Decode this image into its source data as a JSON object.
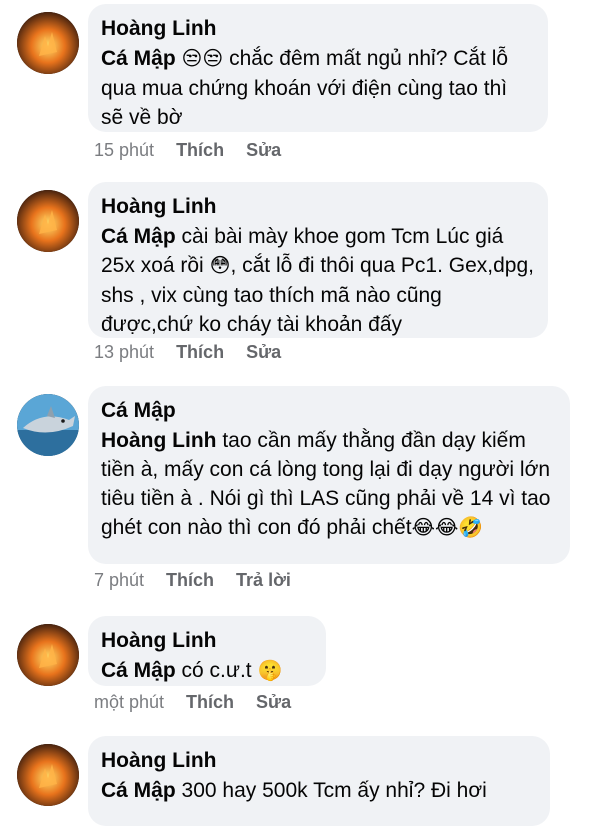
{
  "comments": [
    {
      "author": "Hoàng Linh",
      "mention": "Cá Mập",
      "emojis": "😒😒",
      "text": "chắc đêm mất ngủ nhỉ? Cắt lỗ qua mua chứng khoán với điện cùng tao thì sẽ về bờ",
      "time": "15 phút",
      "like": "Thích",
      "action": "Sửa",
      "avatar": "fire-avatar"
    },
    {
      "author": "Hoàng Linh",
      "mention": "Cá Mập",
      "text": "cài bài mày khoe gom Tcm Lúc giá 25x xoá rồi",
      "emoji_mid": "😳",
      "text2": ", cắt lỗ đi thôi qua Pc1. Gex,dpg, shs , vix cùng tao thích mã nào cũng được,chứ ko cháy tài khoản đấy",
      "time": "13 phút",
      "like": "Thích",
      "action": "Sửa",
      "avatar": "fire-avatar"
    },
    {
      "author": "Cá Mập",
      "mention": "Hoàng Linh",
      "text": "tao cần mấy thằng đần dạy kiếm tiền à, mấy con cá lòng tong lại đi dạy người lớn tiêu tiền à . Nói gì thì LAS cũng phải về 14 vì tao ghét con nào thì con đó phải chết",
      "emojis_end": "😂😂🤣",
      "time": "7 phút",
      "like": "Thích",
      "action": "Trả lời",
      "avatar": "shark-avatar"
    },
    {
      "author": "Hoàng Linh",
      "mention": "Cá Mập",
      "text": "có c.ư.t",
      "emoji_end": "🤫",
      "time": "một phút",
      "like": "Thích",
      "action": "Sửa",
      "avatar": "fire-avatar"
    },
    {
      "author": "Hoàng Linh",
      "mention": "Cá Mập",
      "text": "300 hay 500k Tcm ấy nhỉ? Đi hơi",
      "avatar": "fire-avatar"
    }
  ]
}
